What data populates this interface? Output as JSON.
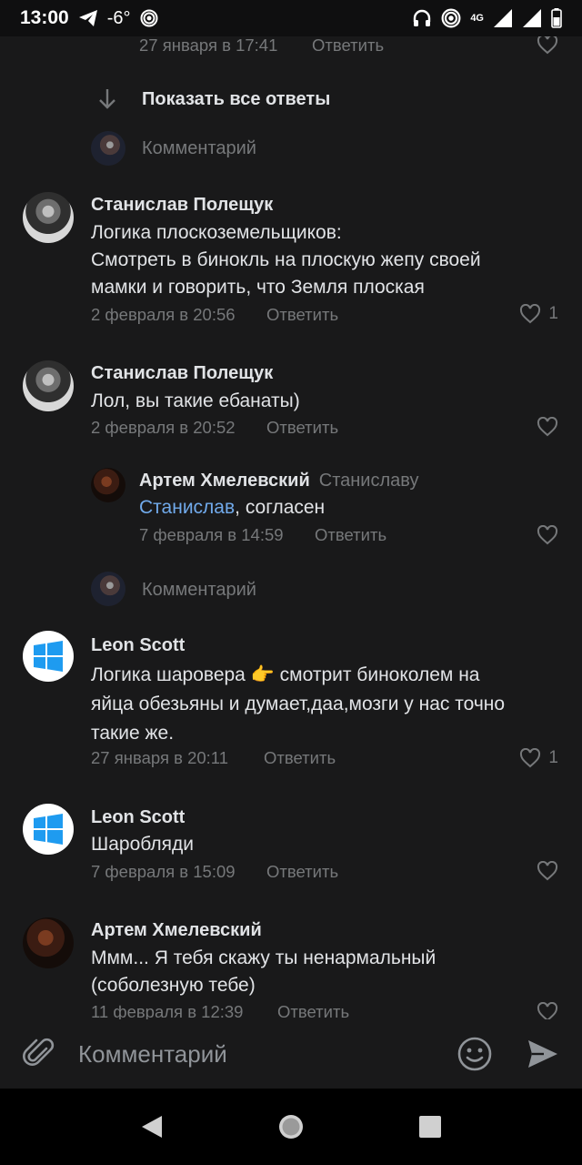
{
  "status_bar": {
    "time": "13:00",
    "temperature": "-6°",
    "network": "4G",
    "icons": [
      "telegram-icon",
      "hotspot-icon",
      "headphones-icon",
      "hotspot-icon",
      "signal-icon",
      "signal-icon",
      "battery-icon"
    ]
  },
  "thread_top": {
    "timestamp": "27 января в 17:41",
    "reply_label": "Ответить",
    "show_all_label": "Показать все ответы",
    "comment_placeholder": "Комментарий"
  },
  "comments": [
    {
      "author": "Станислав Полещук",
      "text_lines": [
        "Логика плоскоземельщиков:",
        "Смотреть в бинокль на плоскую жепу своей",
        "мамки и говорить, что Земля плоская"
      ],
      "timestamp": "2 февраля в 20:56",
      "reply_label": "Ответить",
      "likes": "1"
    },
    {
      "author": "Станислав Полещук",
      "text_lines": [
        "Лол, вы такие ебанаты)"
      ],
      "timestamp": "2 февраля в 20:52",
      "reply_label": "Ответить",
      "likes": ""
    }
  ],
  "reply": {
    "author": "Артем Хмелевский",
    "to": "Станиславу",
    "mention": "Станислав",
    "text": ", согласен",
    "timestamp": "7 февраля в 14:59",
    "reply_label": "Ответить",
    "comment_placeholder": "Комментарий"
  },
  "comments_2": [
    {
      "author": "Leon Scott",
      "text_lines": [
        "Логика шаровера 👉 смотрит биноколем на",
        "яйца обезьяны и думает,даа,мозги у нас точно",
        "такие же."
      ],
      "timestamp": "27 января в 20:11",
      "reply_label": "Ответить",
      "likes": "1"
    },
    {
      "author": "Leon Scott",
      "text_lines": [
        "Шаробляди"
      ],
      "timestamp": "7 февраля в 15:09",
      "reply_label": "Ответить",
      "likes": ""
    },
    {
      "author": "Артем Хмелевский",
      "text_lines": [
        "Ммм... Я тебя скажу ты ненармальный",
        "(соболезную тебе)"
      ],
      "timestamp": "11 февраля в 12:39",
      "reply_label": "Ответить",
      "likes": ""
    }
  ],
  "composer": {
    "placeholder": "Комментарий",
    "icons": [
      "paperclip-icon",
      "emoji-icon",
      "send-icon"
    ]
  },
  "colors": {
    "background": "#19191a",
    "text": "#e1e3e6",
    "secondary": "#76787a",
    "link": "#71aaeb"
  }
}
